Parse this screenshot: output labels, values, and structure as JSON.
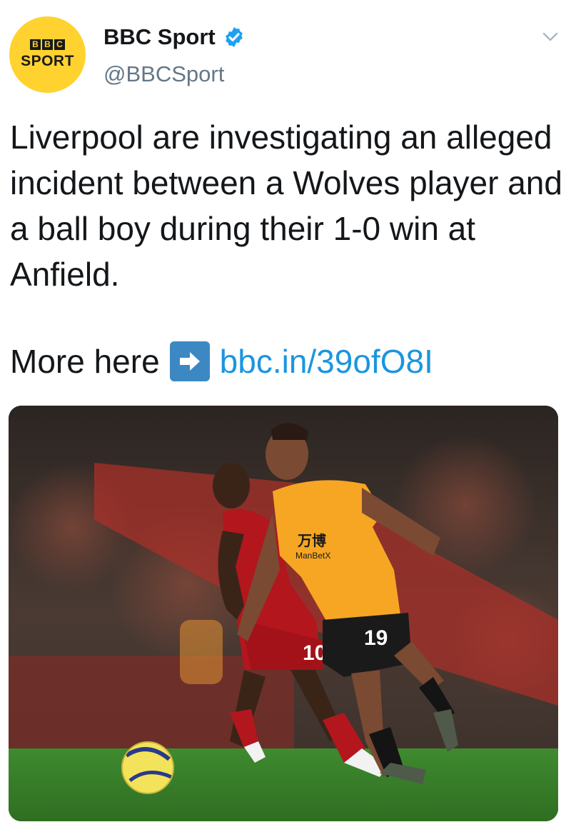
{
  "account": {
    "avatar_blocks": [
      "B",
      "B",
      "C"
    ],
    "avatar_word": "SPORT",
    "display_name": "BBC Sport",
    "handle": "@BBCSport"
  },
  "tweet": {
    "text": "Liverpool are investigating an alleged incident between a Wolves player and a ball boy during their 1-0 win at Anfield.",
    "more_prefix": "More here",
    "link_text": "bbc.in/39ofO8I"
  },
  "media": {
    "left_shirt_number": "10",
    "right_shirt_number": "19",
    "sponsor_text": "万博",
    "sponsor_sub": "ManBetX"
  },
  "colors": {
    "avatar_bg": "#ffd230",
    "link": "#1b95e0",
    "verified": "#1da1f2",
    "arrow_emoji_bg": "#3b88c3"
  }
}
